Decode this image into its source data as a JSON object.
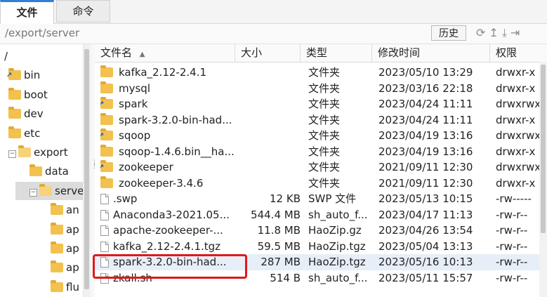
{
  "tabs": [
    {
      "label": "文件"
    },
    {
      "label": "命令"
    }
  ],
  "pathbar": {
    "path": "/export/server",
    "history_label": "历史",
    "tool_icons": "⟳↥⤓⇥"
  },
  "tree": [
    {
      "label": "/",
      "depth": 0
    },
    {
      "label": "bin",
      "depth": 1
    },
    {
      "label": "boot",
      "depth": 1
    },
    {
      "label": "dev",
      "depth": 1
    },
    {
      "label": "etc",
      "depth": 1
    },
    {
      "label": "export",
      "depth": 1
    },
    {
      "label": "data",
      "depth": 2
    },
    {
      "label": "server",
      "depth": 2
    },
    {
      "label": "an",
      "depth": 3
    },
    {
      "label": "ap",
      "depth": 3
    },
    {
      "label": "ap",
      "depth": 3
    },
    {
      "label": "ap",
      "depth": 3
    },
    {
      "label": "flu",
      "depth": 3
    }
  ],
  "columns": {
    "name": "文件名",
    "sort_indicator": "▲",
    "size": "大小",
    "type": "类型",
    "mtime": "修改时间",
    "perm": "权限"
  },
  "files": [
    {
      "name": "kafka_2.12-2.4.1",
      "size": "",
      "type": "文件夹",
      "mtime": "2023/05/10 13:29",
      "perm": "drwxr-x",
      "icon": "folder"
    },
    {
      "name": "mysql",
      "size": "",
      "type": "文件夹",
      "mtime": "2023/03/16 22:18",
      "perm": "drwxr-x",
      "icon": "folder"
    },
    {
      "name": "spark",
      "size": "",
      "type": "文件夹",
      "mtime": "2023/04/24 11:11",
      "perm": "drwxrwx",
      "icon": "folder-link"
    },
    {
      "name": "spark-3.2.0-bin-had...",
      "size": "",
      "type": "文件夹",
      "mtime": "2023/04/24 11:11",
      "perm": "drwxr-x",
      "icon": "folder"
    },
    {
      "name": "sqoop",
      "size": "",
      "type": "文件夹",
      "mtime": "2023/04/19 13:16",
      "perm": "drwxrwx",
      "icon": "folder-link"
    },
    {
      "name": "sqoop-1.4.6.bin__ha...",
      "size": "",
      "type": "文件夹",
      "mtime": "2023/04/19 13:16",
      "perm": "drwxr-x",
      "icon": "folder"
    },
    {
      "name": "zookeeper",
      "size": "",
      "type": "文件夹",
      "mtime": "2021/09/11 12:30",
      "perm": "drwxrwx",
      "icon": "folder-link"
    },
    {
      "name": "zookeeper-3.4.6",
      "size": "",
      "type": "文件夹",
      "mtime": "2021/09/11 12:30",
      "perm": "drwxr-x",
      "icon": "folder"
    },
    {
      "name": ".swp",
      "size": "12 KB",
      "type": "SWP 文件",
      "mtime": "2023/05/13 10:15",
      "perm": "-rw-----",
      "icon": "file"
    },
    {
      "name": "Anaconda3-2021.05...",
      "size": "544.4 MB",
      "type": "sh_auto_f...",
      "mtime": "2023/04/17 11:13",
      "perm": "-rw-r--",
      "icon": "file"
    },
    {
      "name": "apache-zookeeper-...",
      "size": "11.8 MB",
      "type": "HaoZip.gz",
      "mtime": "2023/04/26 13:54",
      "perm": "-rw-r--",
      "icon": "file"
    },
    {
      "name": "kafka_2.12-2.4.1.tgz",
      "size": "59.5 MB",
      "type": "HaoZip.tgz",
      "mtime": "2023/05/04 13:13",
      "perm": "-rw-r--",
      "icon": "file"
    },
    {
      "name": "spark-3.2.0-bin-had...",
      "size": "287 MB",
      "type": "HaoZip.tgz",
      "mtime": "2023/05/16 10:13",
      "perm": "-rw-r--",
      "icon": "file",
      "selected": true
    },
    {
      "name": "zkall.sh",
      "size": "514 B",
      "type": "sh_auto_f...",
      "mtime": "2023/05/11 15:57",
      "perm": "-rw-r--",
      "icon": "file"
    }
  ],
  "colors": {
    "accent": "#2f7fd6",
    "selection": "#e6eff7",
    "highlight_box": "#e01919",
    "folder": "#f2c14e"
  }
}
